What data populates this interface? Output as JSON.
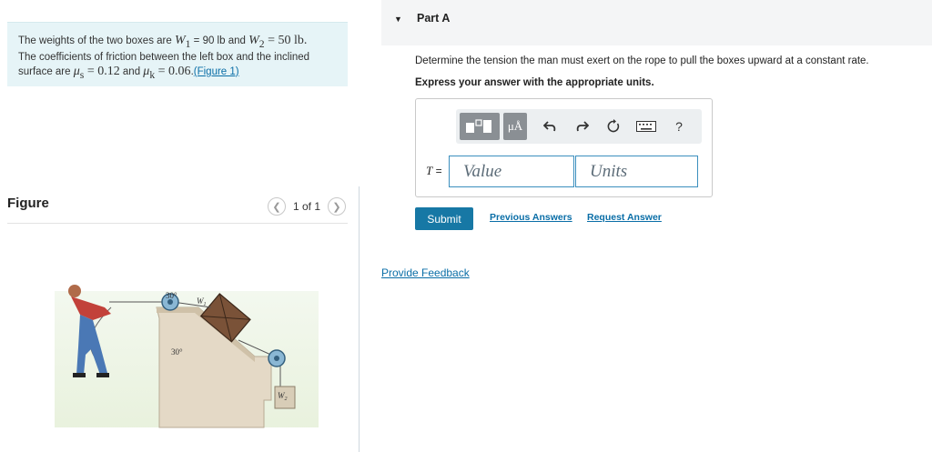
{
  "problem": {
    "text_1": "The weights of the two boxes are",
    "w1_symbol": "W",
    "w1_sub": "1",
    "w1_value": " = 90 lb",
    "and_1": " and ",
    "w2_symbol": "W",
    "w2_sub": "2",
    "w2_value": " = 50 lb.",
    "text_2": "The coefficients of friction between the left box and the inclined",
    "text_3": "surface are",
    "mus_symbol": "μ",
    "mus_sub": "s",
    "mus_value": " = 0.12",
    "and_2": " and ",
    "muk_symbol": "μ",
    "muk_sub": "k",
    "muk_value": " = 0.06",
    "text_4": ".",
    "figure_link": "(Figure 1)"
  },
  "figure": {
    "title": "Figure",
    "pager_text": "1 of 1",
    "labels": {
      "angle_top": "30°",
      "angle_bottom": "30°",
      "box1": "W",
      "box1_sub": "1",
      "box2": "W",
      "box2_sub": "2"
    }
  },
  "part": {
    "title": "Part A",
    "question": "Determine the tension the man must exert on the rope to pull the boxes upward at a constant rate.",
    "instruction": "Express your answer with the appropriate units."
  },
  "toolbar": {
    "icons": [
      "templates-icon",
      "mu-angstrom-icon",
      "undo-icon",
      "redo-icon",
      "reset-icon",
      "keyboard-icon",
      "help-icon"
    ],
    "mu_label": "μÅ",
    "help_label": "?"
  },
  "answer": {
    "variable": "T",
    "equals": " =",
    "value_placeholder": "Value",
    "units_placeholder": "Units"
  },
  "actions": {
    "submit": "Submit",
    "previous_answers": "Previous Answers",
    "request_answer": "Request Answer",
    "provide_feedback": "Provide Feedback"
  },
  "colors": {
    "problem_bg": "#e6f4f7",
    "link": "#0a6ea7",
    "submit_bg": "#1778a5",
    "field_border": "#3b8fbe"
  }
}
